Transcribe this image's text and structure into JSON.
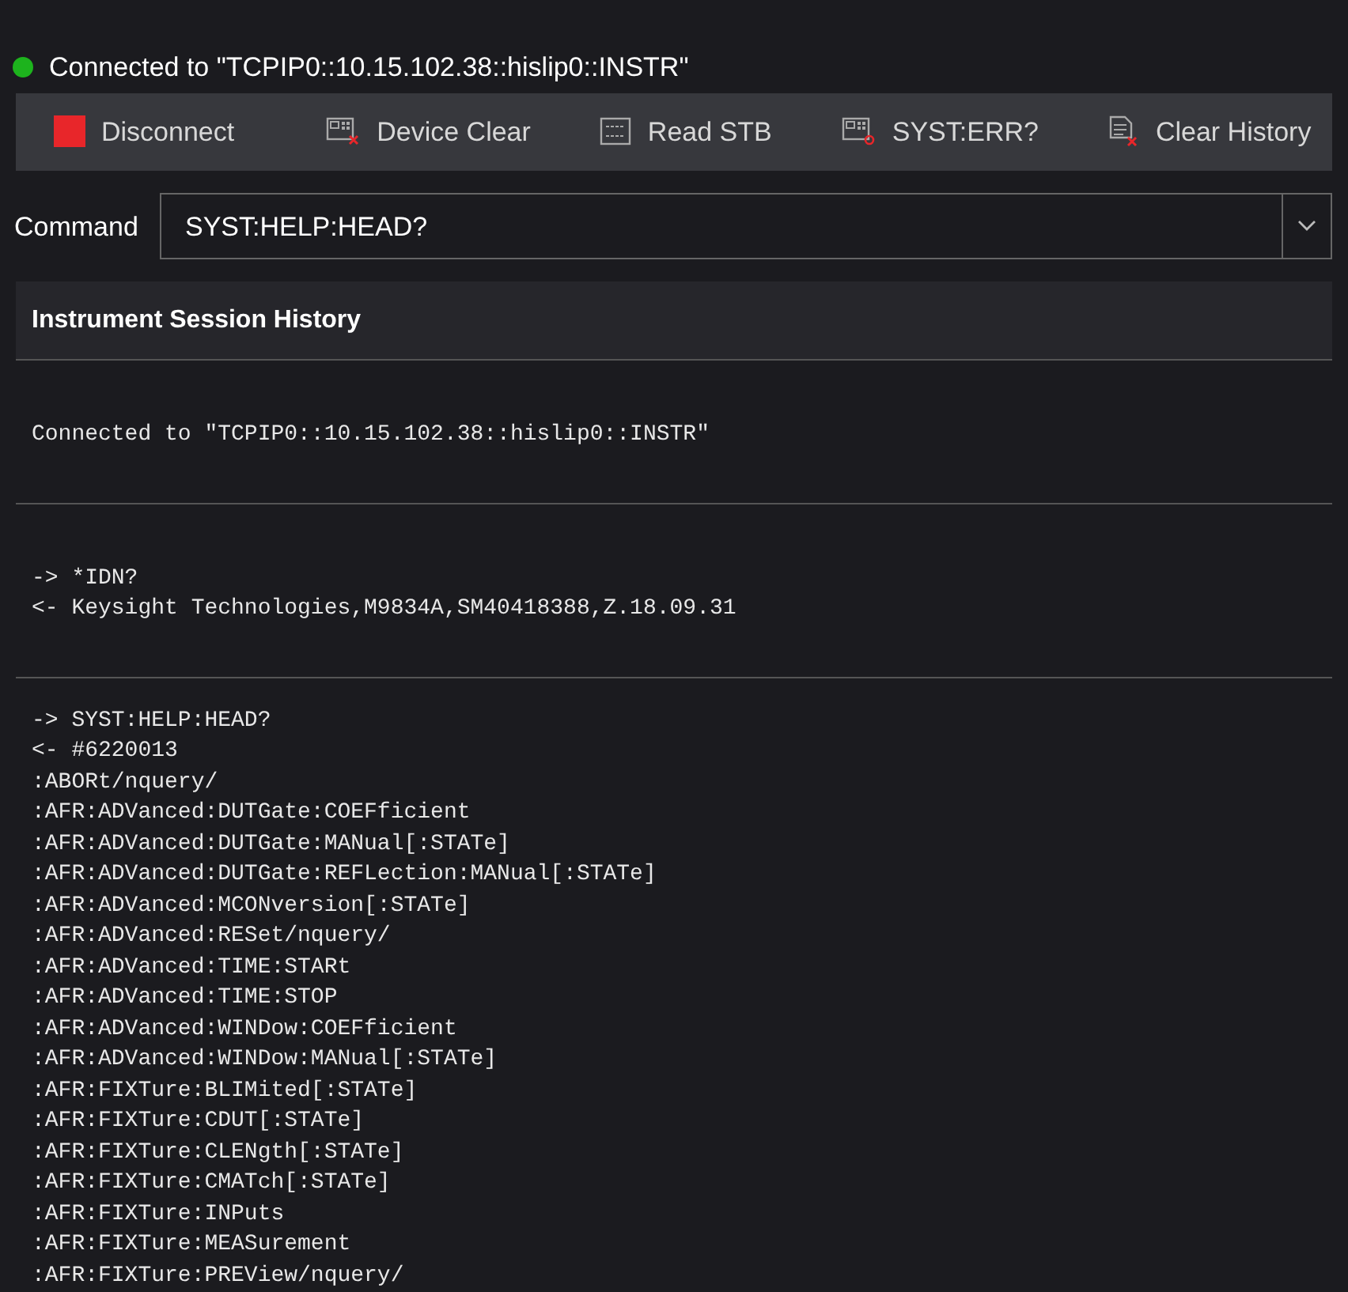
{
  "status": {
    "connected": true,
    "text": "Connected to \"TCPIP0::10.15.102.38::hislip0::INSTR\""
  },
  "toolbar": [
    {
      "kind": "disconnect",
      "label": "Disconnect"
    },
    {
      "kind": "device-clear",
      "label": "Device Clear"
    },
    {
      "kind": "read-stb",
      "label": "Read STB"
    },
    {
      "kind": "syst-err",
      "label": "SYST:ERR?"
    },
    {
      "kind": "clear-history",
      "label": "Clear History"
    }
  ],
  "command": {
    "label": "Command",
    "value": "SYST:HELP:HEAD?"
  },
  "history": {
    "title": "Instrument Session History",
    "entries": [
      {
        "lines": [
          "Connected to \"TCPIP0::10.15.102.38::hislip0::INSTR\""
        ]
      },
      {
        "lines": [
          "-> *IDN?",
          "<- Keysight Technologies,M9834A,SM40418388,Z.18.09.31"
        ]
      },
      {
        "lines": [
          "-> SYST:HELP:HEAD?",
          "<- #6220013",
          ":ABORt/nquery/",
          ":AFR:ADVanced:DUTGate:COEFficient",
          ":AFR:ADVanced:DUTGate:MANual[:STATe]",
          ":AFR:ADVanced:DUTGate:REFLection:MANual[:STATe]",
          ":AFR:ADVanced:MCONversion[:STATe]",
          ":AFR:ADVanced:RESet/nquery/",
          ":AFR:ADVanced:TIME:STARt",
          ":AFR:ADVanced:TIME:STOP",
          ":AFR:ADVanced:WINDow:COEFficient",
          ":AFR:ADVanced:WINDow:MANual[:STATe]",
          ":AFR:FIXTure:BLIMited[:STATe]",
          ":AFR:FIXTure:CDUT[:STATe]",
          ":AFR:FIXTure:CLENgth[:STATe]",
          ":AFR:FIXTure:CMATch[:STATe]",
          ":AFR:FIXTure:INPuts",
          ":AFR:FIXTure:MEASurement",
          ":AFR:FIXTure:PREView/nquery/"
        ]
      }
    ]
  }
}
